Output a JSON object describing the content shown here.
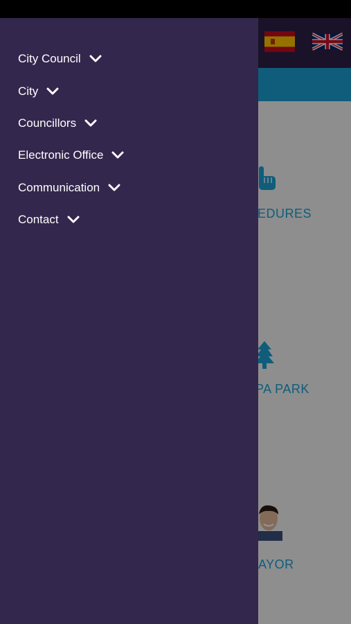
{
  "colors": {
    "drawer_bg": "#34274d",
    "header_bg": "#2d1f47",
    "accent": "#1aa0d4",
    "menu_text": "#ffffff"
  },
  "header": {
    "languages": [
      {
        "icon": "spain-flag-icon"
      },
      {
        "icon": "uk-flag-icon"
      }
    ]
  },
  "drawer": {
    "items": [
      {
        "label": "City Council",
        "icon": "chevron-down-icon"
      },
      {
        "label": "City",
        "icon": "chevron-down-icon"
      },
      {
        "label": "Councillors",
        "icon": "chevron-down-icon"
      },
      {
        "label": "Electronic Office",
        "icon": "chevron-down-icon"
      },
      {
        "label": "Communication",
        "icon": "chevron-down-icon"
      },
      {
        "label": "Contact",
        "icon": "chevron-down-icon"
      }
    ]
  },
  "tiles": [
    {
      "label": "EDURES",
      "icon": "hand-pointer-icon"
    },
    {
      "label": "PA PARK",
      "icon": "tree-icon"
    },
    {
      "label": "AYOR",
      "icon": "mayor-photo"
    }
  ]
}
